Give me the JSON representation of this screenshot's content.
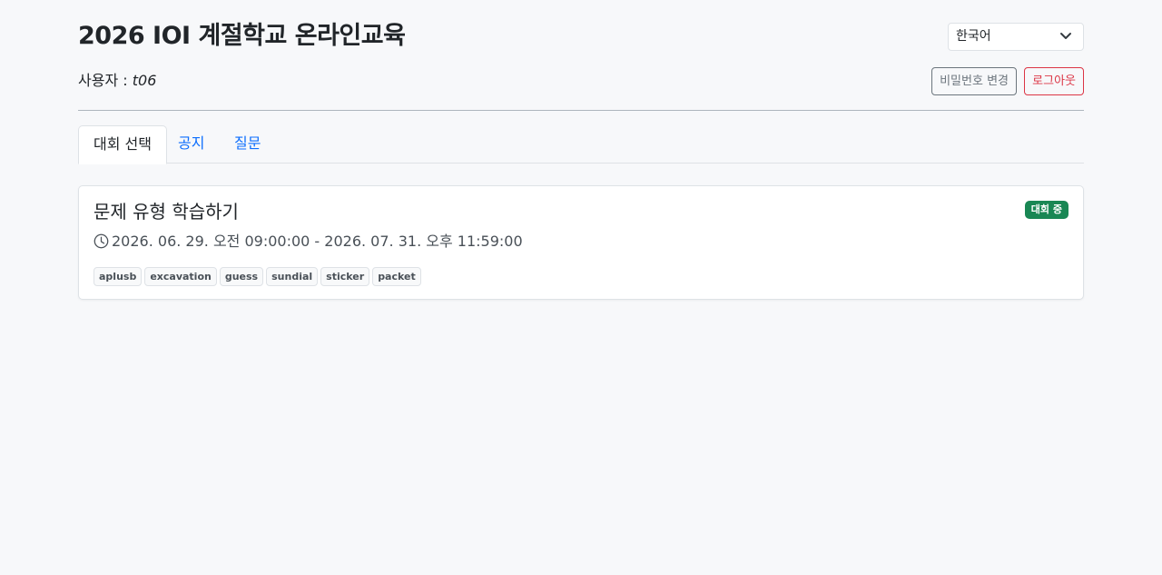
{
  "header": {
    "title": "2026 IOI 계절학교 온라인교육",
    "language": {
      "selected": "한국어",
      "icon": "chevron-down-icon"
    },
    "user_label": "사용자 : ",
    "username": "t06",
    "change_password_label": "비밀번호 변경",
    "logout_label": "로그아웃"
  },
  "tabs": [
    {
      "label": "대회 선택",
      "active": true
    },
    {
      "label": "공지",
      "active": false
    },
    {
      "label": "질문",
      "active": false
    }
  ],
  "contest": {
    "title": "문제 유형 학습하기",
    "status_badge": "대회 중",
    "time_icon": "clock-icon",
    "time_range": "2026. 06. 29. 오전 09:00:00 - 2026. 07. 31. 오후 11:59:00",
    "problems": [
      "aplusb",
      "excavation",
      "guess",
      "sundial",
      "sticker",
      "packet"
    ]
  },
  "colors": {
    "accent": "#0d6efd",
    "success": "#198754",
    "danger": "#dc3545",
    "secondary": "#6c757d",
    "background": "#f7f8fa"
  }
}
